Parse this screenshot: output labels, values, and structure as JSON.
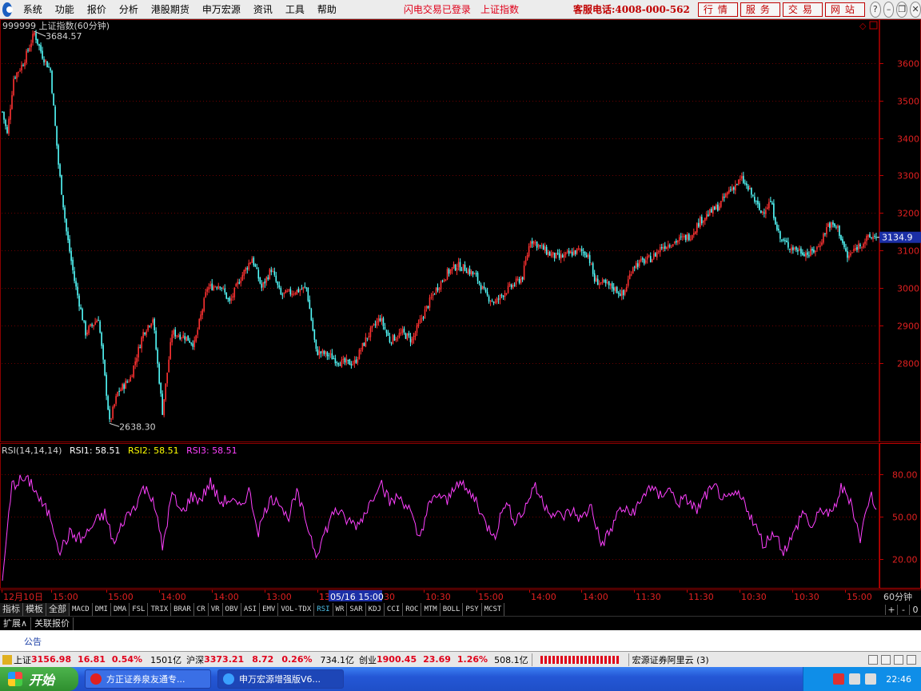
{
  "menu": {
    "items": [
      "系统",
      "功能",
      "报价",
      "分析",
      "港股期货",
      "申万宏源",
      "资讯",
      "工具",
      "帮助"
    ],
    "notice1": "闪电交易已登录",
    "notice2": "上证指数",
    "hotline": "客服电话:4008-000-562",
    "top_buttons": [
      "行情",
      "服务",
      "交易",
      "网站"
    ],
    "window_buttons": [
      "help-icon",
      "minimize-icon",
      "restore-icon",
      "close-icon"
    ]
  },
  "chart_data": [
    {
      "type": "candlestick",
      "title": "999999 上证指数(60分钟)",
      "y_ticks": [
        2800,
        2900,
        3000,
        3100,
        3200,
        3300,
        3400,
        3500,
        3600
      ],
      "ylim": [
        2590,
        3700
      ],
      "last_price": "3134.9",
      "high_mark": {
        "label": "3684.57",
        "value": 3684.57
      },
      "low_mark": {
        "label": "2638.30",
        "value": 2638.3
      },
      "waypoints": [
        {
          "i": 0,
          "v": 3470
        },
        {
          "i": 3,
          "v": 3410
        },
        {
          "i": 7,
          "v": 3560
        },
        {
          "i": 13,
          "v": 3600
        },
        {
          "i": 20,
          "v": 3680
        },
        {
          "i": 25,
          "v": 3620
        },
        {
          "i": 30,
          "v": 3580
        },
        {
          "i": 35,
          "v": 3330
        },
        {
          "i": 40,
          "v": 3150
        },
        {
          "i": 45,
          "v": 3020
        },
        {
          "i": 52,
          "v": 2880
        },
        {
          "i": 60,
          "v": 2920
        },
        {
          "i": 67,
          "v": 2640
        },
        {
          "i": 72,
          "v": 2720
        },
        {
          "i": 80,
          "v": 2760
        },
        {
          "i": 88,
          "v": 2880
        },
        {
          "i": 94,
          "v": 2920
        },
        {
          "i": 100,
          "v": 2670
        },
        {
          "i": 106,
          "v": 2880
        },
        {
          "i": 114,
          "v": 2870
        },
        {
          "i": 120,
          "v": 2850
        },
        {
          "i": 128,
          "v": 3000
        },
        {
          "i": 136,
          "v": 3010
        },
        {
          "i": 142,
          "v": 2960
        },
        {
          "i": 148,
          "v": 3020
        },
        {
          "i": 156,
          "v": 3080
        },
        {
          "i": 162,
          "v": 3000
        },
        {
          "i": 168,
          "v": 3050
        },
        {
          "i": 174,
          "v": 2980
        },
        {
          "i": 182,
          "v": 2990
        },
        {
          "i": 190,
          "v": 3000
        },
        {
          "i": 196,
          "v": 2830
        },
        {
          "i": 204,
          "v": 2820
        },
        {
          "i": 212,
          "v": 2800
        },
        {
          "i": 220,
          "v": 2800
        },
        {
          "i": 228,
          "v": 2870
        },
        {
          "i": 236,
          "v": 2920
        },
        {
          "i": 242,
          "v": 2860
        },
        {
          "i": 250,
          "v": 2880
        },
        {
          "i": 256,
          "v": 2860
        },
        {
          "i": 262,
          "v": 2920
        },
        {
          "i": 270,
          "v": 2990
        },
        {
          "i": 278,
          "v": 3040
        },
        {
          "i": 284,
          "v": 3060
        },
        {
          "i": 290,
          "v": 3050
        },
        {
          "i": 296,
          "v": 3030
        },
        {
          "i": 302,
          "v": 2980
        },
        {
          "i": 308,
          "v": 2960
        },
        {
          "i": 314,
          "v": 2990
        },
        {
          "i": 320,
          "v": 3010
        },
        {
          "i": 325,
          "v": 3030
        },
        {
          "i": 330,
          "v": 3130
        },
        {
          "i": 336,
          "v": 3110
        },
        {
          "i": 342,
          "v": 3090
        },
        {
          "i": 348,
          "v": 3080
        },
        {
          "i": 354,
          "v": 3090
        },
        {
          "i": 360,
          "v": 3100
        },
        {
          "i": 366,
          "v": 3090
        },
        {
          "i": 370,
          "v": 3020
        },
        {
          "i": 376,
          "v": 3010
        },
        {
          "i": 382,
          "v": 3000
        },
        {
          "i": 388,
          "v": 2980
        },
        {
          "i": 394,
          "v": 3060
        },
        {
          "i": 400,
          "v": 3070
        },
        {
          "i": 406,
          "v": 3080
        },
        {
          "i": 412,
          "v": 3110
        },
        {
          "i": 418,
          "v": 3120
        },
        {
          "i": 424,
          "v": 3130
        },
        {
          "i": 430,
          "v": 3140
        },
        {
          "i": 436,
          "v": 3180
        },
        {
          "i": 442,
          "v": 3200
        },
        {
          "i": 448,
          "v": 3220
        },
        {
          "i": 454,
          "v": 3260
        },
        {
          "i": 462,
          "v": 3290
        },
        {
          "i": 468,
          "v": 3250
        },
        {
          "i": 474,
          "v": 3200
        },
        {
          "i": 480,
          "v": 3230
        },
        {
          "i": 486,
          "v": 3130
        },
        {
          "i": 492,
          "v": 3110
        },
        {
          "i": 498,
          "v": 3100
        },
        {
          "i": 504,
          "v": 3090
        },
        {
          "i": 510,
          "v": 3110
        },
        {
          "i": 516,
          "v": 3170
        },
        {
          "i": 522,
          "v": 3160
        },
        {
          "i": 528,
          "v": 3080
        },
        {
          "i": 534,
          "v": 3110
        },
        {
          "i": 540,
          "v": 3130
        },
        {
          "i": 546,
          "v": 3140
        }
      ],
      "legend": "",
      "x_ticks": [
        "12月10日",
        "15:00",
        "15:00",
        "14:00",
        "14:00",
        "13:00",
        "13:00",
        "13:30",
        "10:30",
        "15:00",
        "14:00",
        "14:00",
        "11:30",
        "11:30",
        "10:30",
        "10:30",
        "15:00"
      ],
      "x_ticks_partial": [
        "13",
        "30"
      ],
      "x_cursor_label": "05/16 15:00",
      "x_period": "60分钟"
    },
    {
      "type": "line",
      "title": "RSI(14,14,14)",
      "series": [
        {
          "name": "RSI1",
          "value_label": "58.51",
          "color": "#ffffff"
        },
        {
          "name": "RSI2",
          "value_label": "58.51",
          "color": "#ffff00"
        },
        {
          "name": "RSI3",
          "value_label": "58.51",
          "color": "#ff40ff"
        }
      ],
      "y_ticks": [
        "80.00",
        "50.00",
        "20.00"
      ],
      "ylim": [
        0,
        100
      ],
      "waypoints": [
        {
          "i": 0,
          "v": 5
        },
        {
          "i": 3,
          "v": 40
        },
        {
          "i": 6,
          "v": 72
        },
        {
          "i": 12,
          "v": 76
        },
        {
          "i": 18,
          "v": 74
        },
        {
          "i": 24,
          "v": 60
        },
        {
          "i": 30,
          "v": 50
        },
        {
          "i": 36,
          "v": 26
        },
        {
          "i": 42,
          "v": 38
        },
        {
          "i": 50,
          "v": 34
        },
        {
          "i": 58,
          "v": 46
        },
        {
          "i": 64,
          "v": 52
        },
        {
          "i": 70,
          "v": 30
        },
        {
          "i": 76,
          "v": 48
        },
        {
          "i": 82,
          "v": 56
        },
        {
          "i": 88,
          "v": 70
        },
        {
          "i": 94,
          "v": 64
        },
        {
          "i": 100,
          "v": 28
        },
        {
          "i": 106,
          "v": 66
        },
        {
          "i": 112,
          "v": 52
        },
        {
          "i": 118,
          "v": 64
        },
        {
          "i": 124,
          "v": 62
        },
        {
          "i": 130,
          "v": 74
        },
        {
          "i": 136,
          "v": 60
        },
        {
          "i": 142,
          "v": 62
        },
        {
          "i": 148,
          "v": 56
        },
        {
          "i": 154,
          "v": 68
        },
        {
          "i": 160,
          "v": 40
        },
        {
          "i": 166,
          "v": 60
        },
        {
          "i": 172,
          "v": 64
        },
        {
          "i": 178,
          "v": 48
        },
        {
          "i": 184,
          "v": 66
        },
        {
          "i": 190,
          "v": 46
        },
        {
          "i": 196,
          "v": 24
        },
        {
          "i": 202,
          "v": 40
        },
        {
          "i": 208,
          "v": 56
        },
        {
          "i": 214,
          "v": 48
        },
        {
          "i": 222,
          "v": 44
        },
        {
          "i": 230,
          "v": 60
        },
        {
          "i": 236,
          "v": 76
        },
        {
          "i": 242,
          "v": 60
        },
        {
          "i": 248,
          "v": 64
        },
        {
          "i": 254,
          "v": 56
        },
        {
          "i": 260,
          "v": 34
        },
        {
          "i": 266,
          "v": 56
        },
        {
          "i": 272,
          "v": 66
        },
        {
          "i": 278,
          "v": 60
        },
        {
          "i": 284,
          "v": 76
        },
        {
          "i": 290,
          "v": 68
        },
        {
          "i": 296,
          "v": 62
        },
        {
          "i": 302,
          "v": 44
        },
        {
          "i": 308,
          "v": 38
        },
        {
          "i": 314,
          "v": 60
        },
        {
          "i": 320,
          "v": 48
        },
        {
          "i": 326,
          "v": 54
        },
        {
          "i": 332,
          "v": 72
        },
        {
          "i": 338,
          "v": 60
        },
        {
          "i": 344,
          "v": 52
        },
        {
          "i": 350,
          "v": 50
        },
        {
          "i": 356,
          "v": 54
        },
        {
          "i": 362,
          "v": 48
        },
        {
          "i": 368,
          "v": 58
        },
        {
          "i": 374,
          "v": 30
        },
        {
          "i": 380,
          "v": 40
        },
        {
          "i": 386,
          "v": 56
        },
        {
          "i": 392,
          "v": 52
        },
        {
          "i": 398,
          "v": 58
        },
        {
          "i": 404,
          "v": 72
        },
        {
          "i": 410,
          "v": 64
        },
        {
          "i": 416,
          "v": 70
        },
        {
          "i": 422,
          "v": 60
        },
        {
          "i": 428,
          "v": 62
        },
        {
          "i": 434,
          "v": 54
        },
        {
          "i": 440,
          "v": 66
        },
        {
          "i": 446,
          "v": 70
        },
        {
          "i": 452,
          "v": 60
        },
        {
          "i": 458,
          "v": 66
        },
        {
          "i": 464,
          "v": 60
        },
        {
          "i": 470,
          "v": 44
        },
        {
          "i": 476,
          "v": 30
        },
        {
          "i": 482,
          "v": 40
        },
        {
          "i": 488,
          "v": 26
        },
        {
          "i": 494,
          "v": 36
        },
        {
          "i": 500,
          "v": 54
        },
        {
          "i": 506,
          "v": 42
        },
        {
          "i": 512,
          "v": 56
        },
        {
          "i": 518,
          "v": 50
        },
        {
          "i": 524,
          "v": 70
        },
        {
          "i": 530,
          "v": 62
        },
        {
          "i": 536,
          "v": 34
        },
        {
          "i": 542,
          "v": 66
        },
        {
          "i": 546,
          "v": 58
        }
      ]
    }
  ],
  "ind_tabs": {
    "left": [
      "指标",
      "模板",
      "全部"
    ],
    "items": [
      "MACD",
      "DMI",
      "DMA",
      "FSL",
      "TRIX",
      "BRAR",
      "CR",
      "VR",
      "OBV",
      "ASI",
      "EMV",
      "VOL-TDX",
      "RSI",
      "WR",
      "SAR",
      "KDJ",
      "CCI",
      "ROC",
      "MTM",
      "BOLL",
      "PSY",
      "MCST"
    ],
    "active": "RSI",
    "right": [
      "+",
      "-",
      "0"
    ]
  },
  "ext_tabs": [
    "扩展∧",
    "关联报价"
  ],
  "notice": "公告",
  "status": {
    "sh_label": "上证",
    "sh_price": "3156.98",
    "sh_chg": "16.81",
    "sh_pct": "0.54%",
    "sh_amt": "1501亿",
    "hs_label": "沪深",
    "hs_price": "3373.21",
    "hs_chg": "8.72",
    "hs_pct": "0.26%",
    "hs_amt": "734.1亿",
    "cy_label": "创业",
    "cy_price": "1900.45",
    "cy_chg": "23.69",
    "cy_pct": "1.26%",
    "cy_amt": "508.1亿",
    "server": "宏源证券阿里云 (3)"
  },
  "taskbar": {
    "start": "开始",
    "tasks": [
      "方正证券泉友通专...",
      "申万宏源增强版V6..."
    ],
    "clock": "22:46"
  }
}
